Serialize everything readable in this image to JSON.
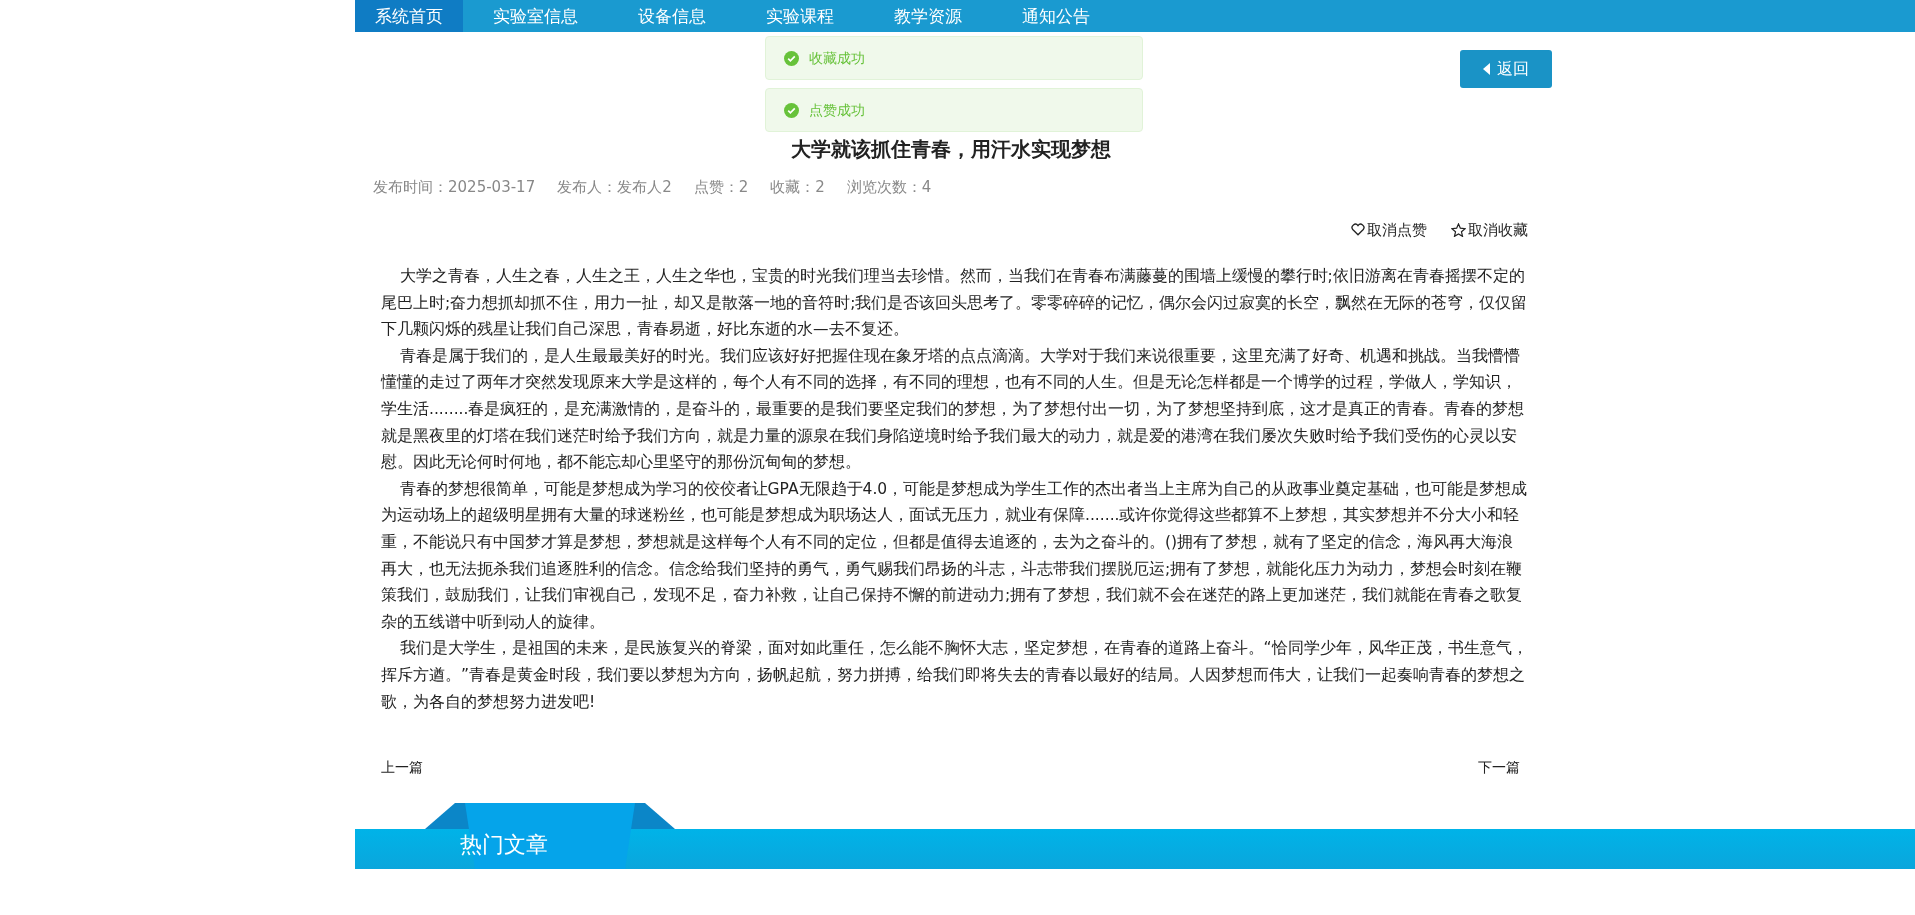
{
  "nav": {
    "items": [
      {
        "label": "系统首页",
        "selected": true
      },
      {
        "label": "实验室信息",
        "selected": false
      },
      {
        "label": "设备信息",
        "selected": false
      },
      {
        "label": "实验课程",
        "selected": false
      },
      {
        "label": "教学资源",
        "selected": false
      },
      {
        "label": "通知公告",
        "selected": false
      }
    ]
  },
  "toasts": [
    {
      "text": "收藏成功"
    },
    {
      "text": "点赞成功"
    }
  ],
  "back_button": {
    "label": "返回"
  },
  "article": {
    "title": "大学就该抓住青春，用汗水实现梦想",
    "meta": [
      "发布时间：2025-03-17",
      "发布人：发布人2",
      "点赞：2",
      "收藏：2",
      "浏览次数：4"
    ],
    "actions": [
      {
        "kind": "like",
        "label": "取消点赞"
      },
      {
        "kind": "collect",
        "label": "取消收藏"
      }
    ],
    "paragraphs": [
      "大学之青春，人生之春，人生之王，人生之华也，宝贵的时光我们理当去珍惜。然而，当我们在青春布满藤蔓的围墙上缓慢的攀行时;依旧游离在青春摇摆不定的尾巴上时;奋力想抓却抓不住，用力一扯，却又是散落一地的音符时;我们是否该回头思考了。零零碎碎的记忆，偶尔会闪过寂寞的长空，飘然在无际的苍穹，仅仅留下几颗闪烁的残星让我们自己深思，青春易逝，好比东逝的水—去不复还。",
      "青春是属于我们的，是人生最最美好的时光。我们应该好好把握住现在象牙塔的点点滴滴。大学对于我们来说很重要，这里充满了好奇、机遇和挑战。当我懵懵懂懂的走过了两年才突然发现原来大学是这样的，每个人有不同的选择，有不同的理想，也有不同的人生。但是无论怎样都是一个博学的过程，学做人，学知识，学生活........春是疯狂的，是充满激情的，是奋斗的，最重要的是我们要坚定我们的梦想，为了梦想付出一切，为了梦想坚持到底，这才是真正的青春。青春的梦想就是黑夜里的灯塔在我们迷茫时给予我们方向，就是力量的源泉在我们身陷逆境时给予我们最大的动力，就是爱的港湾在我们屡次失败时给予我们受伤的心灵以安慰。因此无论何时何地，都不能忘却心里坚守的那份沉甸甸的梦想。",
      "青春的梦想很简单，可能是梦想成为学习的佼佼者让GPA无限趋于4.0，可能是梦想成为学生工作的杰出者当上主席为自己的从政事业奠定基础，也可能是梦想成为运动场上的超级明星拥有大量的球迷粉丝，也可能是梦想成为职场达人，面试无压力，就业有保障.......或许你觉得这些都算不上梦想，其实梦想并不分大小和轻重，不能说只有中国梦才算是梦想，梦想就是这样每个人有不同的定位，但都是值得去追逐的，去为之奋斗的。()拥有了梦想，就有了坚定的信念，海风再大海浪再大，也无法扼杀我们追逐胜利的信念。信念给我们坚持的勇气，勇气赐我们昂扬的斗志，斗志带我们摆脱厄运;拥有了梦想，就能化压力为动力，梦想会时刻在鞭策我们，鼓励我们，让我们审视自己，发现不足，奋力补救，让自己保持不懈的前进动力;拥有了梦想，我们就不会在迷茫的路上更加迷茫，我们就能在青春之歌复杂的五线谱中听到动人的旋律。",
      "我们是大学生，是祖国的未来，是民族复兴的脊梁，面对如此重任，怎么能不胸怀大志，坚定梦想，在青春的道路上奋斗。“恰同学少年，风华正茂，书生意气，挥斥方遒。”青春是黄金时段，我们要以梦想为方向，扬帆起航，努力拼搏，给我们即将失去的青春以最好的结局。人因梦想而伟大，让我们一起奏响青春的梦想之歌，为各自的梦想努力进发吧!"
    ],
    "prev": "上一篇",
    "next": "下一篇"
  },
  "hot_section": {
    "title": "热门文章"
  }
}
